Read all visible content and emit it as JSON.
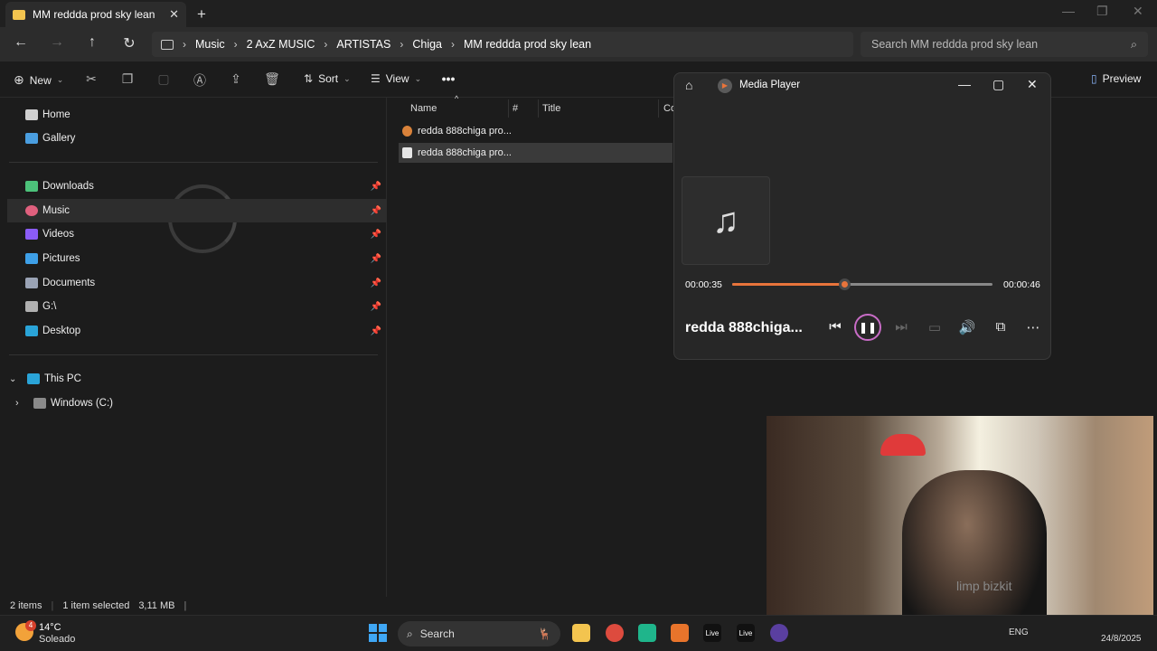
{
  "window": {
    "tab_title": "MM reddda prod sky lean",
    "new_tab": "+",
    "close_tab": "✕"
  },
  "address": {
    "breadcrumbs": [
      "Music",
      "2 AxZ MUSIC",
      "ARTISTAS",
      "Chiga",
      "MM reddda prod sky lean"
    ],
    "search_placeholder": "Search MM reddda prod sky lean"
  },
  "commands": {
    "new_label": "New",
    "sort_label": "Sort",
    "view_label": "View",
    "preview_label": "Preview"
  },
  "sidebar": {
    "top_items": [
      {
        "label": "Home",
        "icon": "home-icon"
      },
      {
        "label": "Gallery",
        "icon": "gallery-icon"
      }
    ],
    "quick_access": [
      {
        "label": "Downloads",
        "icon": "download-icon",
        "color": "#4cc27a"
      },
      {
        "label": "Music",
        "icon": "music-icon",
        "color": "#e0607e"
      },
      {
        "label": "Videos",
        "icon": "video-icon",
        "color": "#8b5cf6"
      },
      {
        "label": "Pictures",
        "icon": "picture-icon",
        "color": "#3ea0e8"
      },
      {
        "label": "Documents",
        "icon": "document-icon",
        "color": "#9aa3b5"
      },
      {
        "label": "G:\\",
        "icon": "drive-icon",
        "color": "#b0b0b0"
      },
      {
        "label": "Desktop",
        "icon": "desktop-icon",
        "color": "#2aa4d8"
      }
    ],
    "this_pc": "This PC",
    "windows_c": "Windows (C:)"
  },
  "filelist": {
    "columns": [
      "Name",
      "#",
      "Title",
      "Co"
    ],
    "files": [
      {
        "name": "redda 888chiga pro...",
        "icon": "audio-file-icon"
      },
      {
        "name": "redda 888chiga pro...",
        "icon": "file-icon"
      }
    ]
  },
  "status": {
    "items": "2 items",
    "selected": "1 item selected",
    "size": "3,11 MB"
  },
  "media_player": {
    "title": "Media Player",
    "current_time": "00:00:35",
    "total_time": "00:00:46",
    "progress": 0.43,
    "song_name": "redda 888chiga...",
    "accent": "#e8743b"
  },
  "webcam": {
    "shirt_text": "limp bizkit"
  },
  "taskbar": {
    "temp": "14°C",
    "condition": "Soleado",
    "weather_badge": "4",
    "search_label": "Search",
    "live1": "Live",
    "live2": "Live",
    "lang": "ENG",
    "date": "24/8/2025"
  }
}
